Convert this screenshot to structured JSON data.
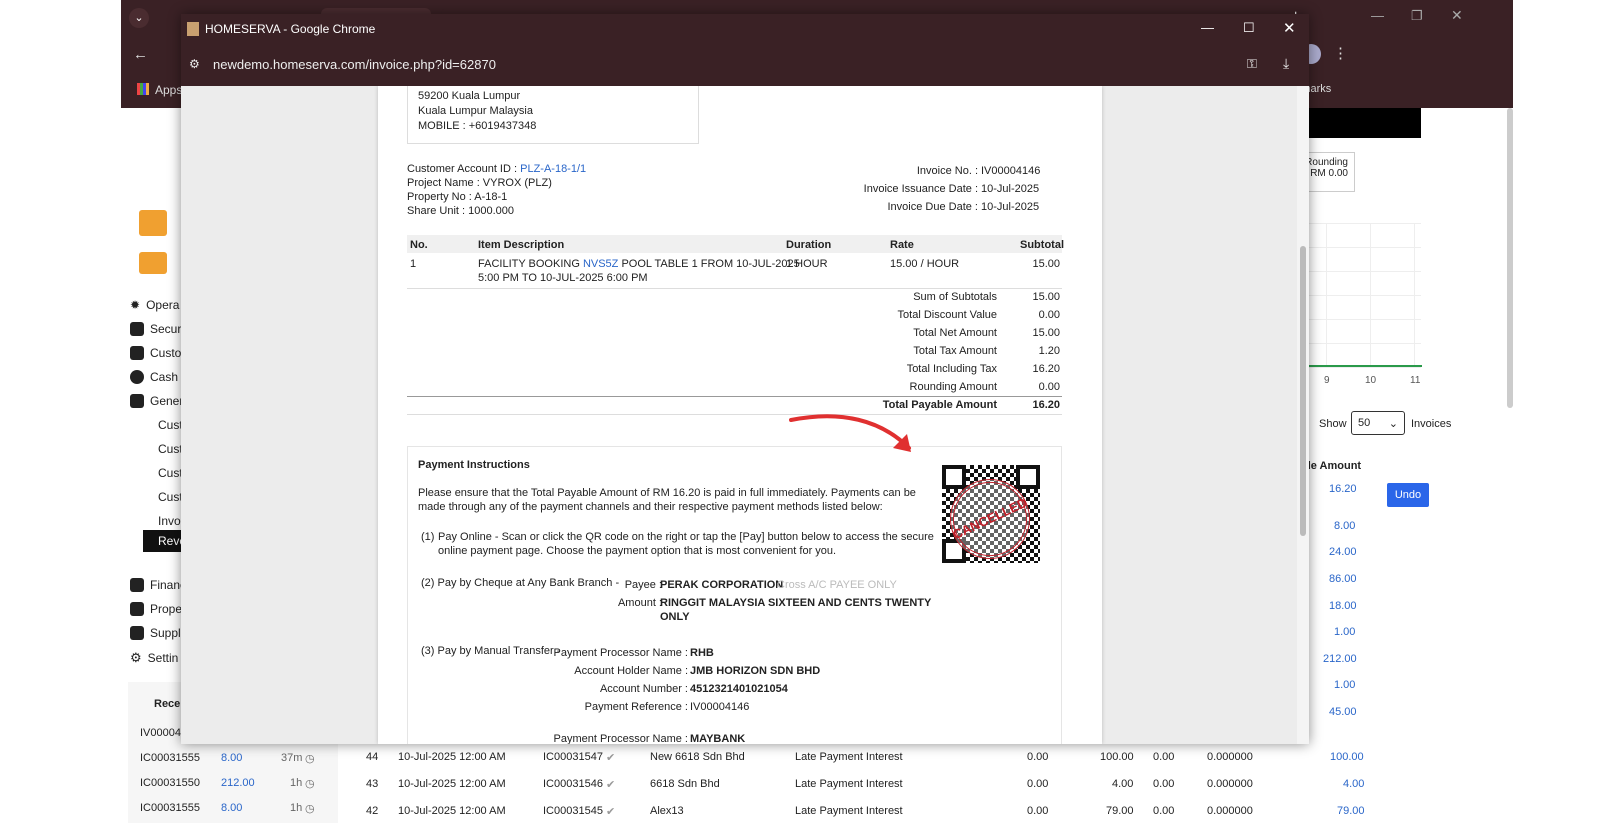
{
  "popup": {
    "window_title": "HOMESERVA - Google Chrome",
    "url": "newdemo.homeserva.com/invoice.php?id=62870"
  },
  "background": {
    "bookmarks_apps": "Apps",
    "bookmarks_all": "All Bookmarks",
    "menu": [
      "Opera",
      "Secur",
      "Custo",
      "Cash",
      "Gener"
    ],
    "submenu": [
      "Cust",
      "Cust",
      "Cust",
      "Cust",
      "Invo",
      "Reve"
    ],
    "menu2": [
      "Financ",
      "Prope",
      "Suppl",
      "Settin"
    ],
    "receipts_title": "Recei",
    "receipts": [
      {
        "id": "IV00004",
        "amount": "",
        "time": ""
      },
      {
        "id": "IC00031555",
        "amount": "8.00",
        "time": "37m"
      },
      {
        "id": "IC00031550",
        "amount": "212.00",
        "time": "1h"
      },
      {
        "id": "IC00031555",
        "amount": "8.00",
        "time": "1h"
      }
    ],
    "rounding_label": "ve Rounding",
    "rounding_value": "RM 0.00",
    "chart_ticks": [
      "8",
      "9",
      "10",
      "11"
    ],
    "show_label": "Show",
    "show_value": "50",
    "invoices_label": "Invoices",
    "payable_header": "ble Amount",
    "undo_label": "Undo",
    "right_amounts": [
      "16.20",
      "8.00",
      "24.00",
      "86.00",
      "18.00",
      "1.00",
      "212.00",
      "1.00",
      "45.00"
    ],
    "table_rows": [
      {
        "no": "44",
        "date": "10-Jul-2025 12:00 AM",
        "ref": "IC00031547",
        "name": "New 6618 Sdn Bhd",
        "desc": "Late Payment Interest",
        "a": "0.00",
        "b": "100.00",
        "c": "0.00",
        "d": "0.000000",
        "e": "100.00"
      },
      {
        "no": "43",
        "date": "10-Jul-2025 12:00 AM",
        "ref": "IC00031546",
        "name": "6618 Sdn Bhd",
        "desc": "Late Payment Interest",
        "a": "0.00",
        "b": "4.00",
        "c": "0.00",
        "d": "0.000000",
        "e": "4.00"
      },
      {
        "no": "42",
        "date": "10-Jul-2025 12:00 AM",
        "ref": "IC00031545",
        "name": "Alex13",
        "desc": "Late Payment Interest",
        "a": "0.00",
        "b": "79.00",
        "c": "0.00",
        "d": "0.000000",
        "e": "79.00"
      }
    ]
  },
  "invoice": {
    "address": [
      "59200 Kuala Lumpur",
      "Kuala Lumpur Malaysia",
      "MOBILE : +6019437348"
    ],
    "account_label": "Customer Account ID : ",
    "account_value": "PLZ-A-18-1/1",
    "project": "Project Name : VYROX (PLZ)",
    "property": "Property No : A-18-1",
    "share": "Share Unit : 1000.000",
    "invoice_no_label": "Invoice No. :",
    "invoice_no": "IV00004146",
    "issue_label": "Invoice Issuance Date :",
    "issue_date": "10-Jul-2025",
    "due_label": "Invoice Due Date :",
    "due_date": "10-Jul-2025",
    "headers": {
      "no": "No.",
      "desc": "Item Description",
      "duration": "Duration",
      "rate": "Rate",
      "subtotal": "Subtotal"
    },
    "item": {
      "no": "1",
      "desc_prefix": "FACILITY BOOKING ",
      "desc_link": "NVS5Z",
      "desc_rest": " POOL TABLE 1 FROM 10-JUL-2025",
      "desc_line2": "5:00 PM TO 10-JUL-2025 6:00 PM",
      "duration": "1 HOUR",
      "rate": "15.00 / HOUR",
      "subtotal": "15.00"
    },
    "totals": [
      {
        "label": "Sum of Subtotals",
        "value": "15.00"
      },
      {
        "label": "Total Discount Value",
        "value": "0.00"
      },
      {
        "label": "Total Net Amount",
        "value": "15.00"
      },
      {
        "label": "Total Tax Amount",
        "value": "1.20"
      },
      {
        "label": "Total Including Tax",
        "value": "16.20"
      },
      {
        "label": "Rounding Amount",
        "value": "0.00"
      }
    ],
    "total_payable_label": "Total Payable Amount",
    "total_payable_value": "16.20",
    "payment": {
      "title": "Payment Instructions",
      "intro1": "Please ensure that the Total Payable Amount of RM 16.20 is paid in full immediately. Payments can be",
      "intro2": "made through any of the payment channels and their respective payment methods listed below:",
      "opt1_num": "(1)",
      "opt1_l1": "Pay Online - Scan or click the QR code on the right or tap the [Pay] button below to access the secure",
      "opt1_l2": "online payment page. Choose the payment option that is most convenient for you.",
      "opt2": "(2) Pay by Cheque at Any Bank Branch -",
      "payee_label": "Payee :",
      "payee_value": "PERAK CORPORATION",
      "payee_note": "Cross A/C PAYEE ONLY",
      "amount_label": "Amount :",
      "amount_l1": "RINGGIT MALAYSIA SIXTEEN AND CENTS TWENTY",
      "amount_l2": "ONLY",
      "opt3": "(3) Pay by Manual Transfer -",
      "ppn_label": "Payment Processor Name :",
      "ppn_value": "RHB",
      "ahn_label": "Account Holder Name :",
      "ahn_value": "JMB HORIZON SDN BHD",
      "an_label": "Account Number :",
      "an_value": "4512321401021054",
      "pr_label": "Payment Reference :",
      "pr_value": "IV00004146",
      "ppn2_label": "Payment Processor Name :",
      "ppn2_value": "MAYBANK",
      "stamp_text": "CANCELLED"
    }
  }
}
